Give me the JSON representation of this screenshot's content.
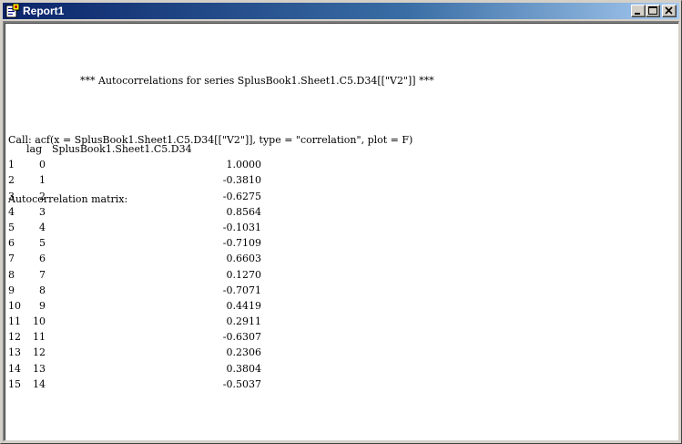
{
  "window": {
    "title": "Report1"
  },
  "report": {
    "heading": "*** Autocorrelations for series SplusBook1.Sheet1.C5.D34[[\"V2\"]] ***",
    "call": "Call: acf(x = SplusBook1.Sheet1.C5.D34[[\"V2\"]], type = \"correlation\", plot = F)",
    "matrix_label": "Autocorrelation matrix:",
    "columns": [
      "lag",
      "SplusBook1.Sheet1.C5.D34"
    ],
    "rows": [
      {
        "idx": "1",
        "lag": "0",
        "value": "1.0000"
      },
      {
        "idx": "2",
        "lag": "1",
        "value": "-0.3810"
      },
      {
        "idx": "3",
        "lag": "2",
        "value": "-0.6275"
      },
      {
        "idx": "4",
        "lag": "3",
        "value": "0.8564"
      },
      {
        "idx": "5",
        "lag": "4",
        "value": "-0.1031"
      },
      {
        "idx": "6",
        "lag": "5",
        "value": "-0.7109"
      },
      {
        "idx": "7",
        "lag": "6",
        "value": "0.6603"
      },
      {
        "idx": "8",
        "lag": "7",
        "value": "0.1270"
      },
      {
        "idx": "9",
        "lag": "8",
        "value": "-0.7071"
      },
      {
        "idx": "10",
        "lag": "9",
        "value": "0.4419"
      },
      {
        "idx": "11",
        "lag": "10",
        "value": "0.2911"
      },
      {
        "idx": "12",
        "lag": "11",
        "value": "-0.6307"
      },
      {
        "idx": "13",
        "lag": "12",
        "value": "0.2306"
      },
      {
        "idx": "14",
        "lag": "13",
        "value": "0.3804"
      },
      {
        "idx": "15",
        "lag": "14",
        "value": "-0.5037"
      }
    ]
  },
  "icons": {
    "app": "report-document-icon",
    "minimize": "minimize-icon",
    "maximize": "maximize-icon",
    "close": "close-icon"
  },
  "colors": {
    "titlebar_start": "#0a246a",
    "titlebar_end": "#a6caf0",
    "chrome": "#d4d0c8"
  }
}
